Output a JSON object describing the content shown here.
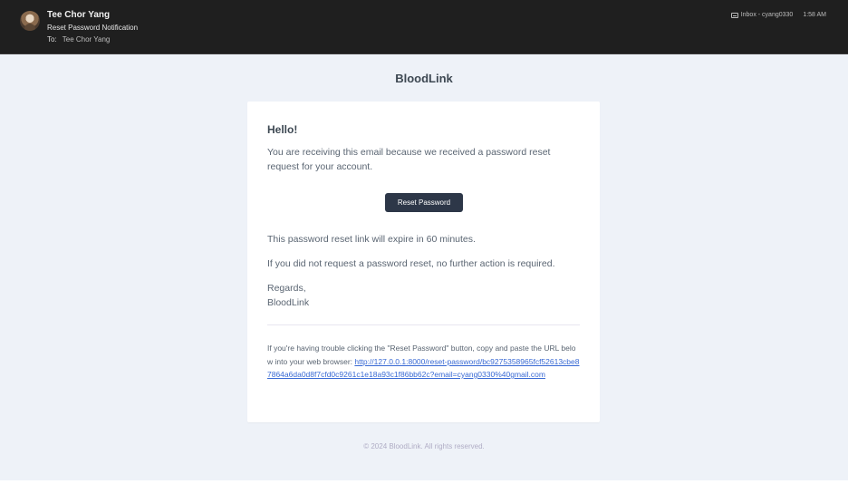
{
  "header": {
    "sender_name": "Tee Chor Yang",
    "subject": "Reset Password Notification",
    "to_label": "To:",
    "to_name": "Tee Chor Yang",
    "folder": "Inbox - cyang0330",
    "time": "1:58 AM",
    "folder_icon": "inbox-icon"
  },
  "email": {
    "brand": "BloodLink",
    "greeting": "Hello!",
    "intro": "You are receiving this email because we received a password reset request for your account.",
    "button_label": "Reset Password",
    "expire_text": "This password reset link will expire in 60 minutes.",
    "no_action_text": "If you did not request a password reset, no further action is required.",
    "regards": "Regards,",
    "signature": "BloodLink",
    "subcopy": "If you're having trouble clicking the \"Reset Password\" button, copy and paste the URL below into your web browser:",
    "url": "http://127.0.0.1:8000/reset-password/bc9275358965fcf52613cbe87864a6da0d8f7cfd0c9261c1e18a93c1f86bb62c?email=cyang0330%40gmail.com",
    "footer": "© 2024 BloodLink. All rights reserved."
  },
  "colors": {
    "header_bg": "#1f1f1f",
    "mail_bg": "#eef2f8",
    "button_bg": "#2d3748",
    "link": "#3869d4"
  }
}
